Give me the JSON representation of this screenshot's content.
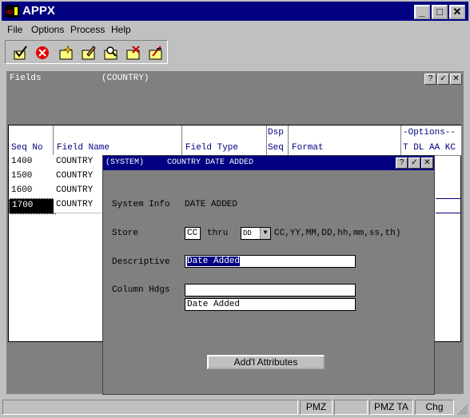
{
  "window": {
    "title": "APPX",
    "min_label": "_",
    "max_label": "□",
    "close_label": "✕"
  },
  "menu": [
    {
      "label": "File"
    },
    {
      "label": "Options"
    },
    {
      "label": "Process"
    },
    {
      "label": "Help"
    }
  ],
  "toolbar": {
    "buttons": [
      "ok-check",
      "cancel",
      "add",
      "change",
      "inquire",
      "delete",
      "scan"
    ]
  },
  "fields_panel": {
    "title": "Fields",
    "subtitle": "(COUNTRY)",
    "help_label": "?",
    "ok_label": "✓",
    "close_label": "✕",
    "columns": {
      "seq_no": "Seq No",
      "field_name": "Field Name",
      "field_type": "Field Type",
      "dsp": "Dsp",
      "seq": "Seq",
      "format": "Format",
      "options": "-Options--",
      "options_sub": "T DL AA KC"
    },
    "rows": [
      {
        "seq": "1400",
        "field": "COUNTRY"
      },
      {
        "seq": "1500",
        "field": "COUNTRY"
      },
      {
        "seq": "1600",
        "field": "COUNTRY"
      },
      {
        "seq": "1700",
        "field": "COUNTRY"
      }
    ]
  },
  "dialog": {
    "system_label": "(SYSTEM)",
    "title": "COUNTRY DATE ADDED",
    "help_label": "?",
    "ok_label": "✓",
    "close_label": "✕",
    "system_info_label": "System Info",
    "system_info_value": "DATE ADDED",
    "store_label": "Store",
    "store_from": "CC",
    "thru_label": "thru",
    "store_to": "DD",
    "store_hint": "CC,YY,MM,DD,hh,mm,ss,th)",
    "descriptive_label": "Descriptive",
    "descriptive_value": "Date Added",
    "column_hdgs_label": "Column Hdgs",
    "column_hdg_1": "",
    "column_hdg_2": "Date Added",
    "addl_button": "Add'l Attributes"
  },
  "status": {
    "seg1": "",
    "seg2": "",
    "pmz": "PMZ",
    "seg4": "",
    "pmz_ta": "PMZ TA",
    "chg": "Chg"
  }
}
